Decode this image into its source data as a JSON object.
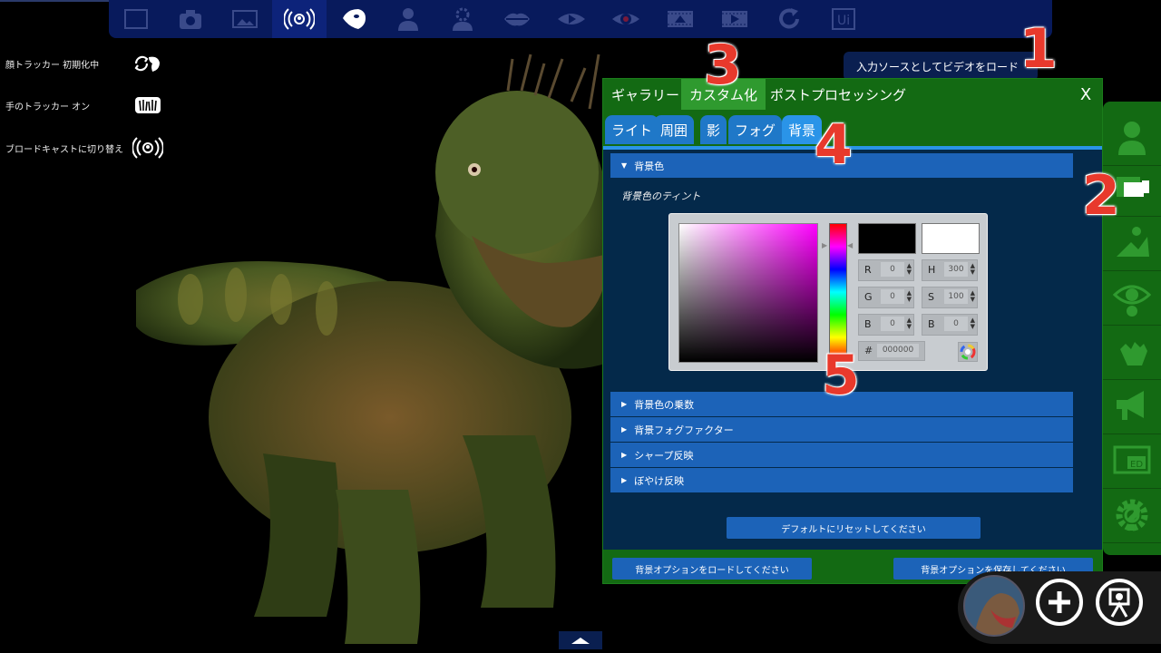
{
  "toolbar": {
    "items": [
      {
        "icon": "fullscreen-icon"
      },
      {
        "icon": "camera-icon"
      },
      {
        "icon": "picture-frame-icon"
      },
      {
        "icon": "broadcast-icon"
      },
      {
        "icon": "face-mask-icon"
      },
      {
        "icon": "person-icon"
      },
      {
        "icon": "person-gear-icon"
      },
      {
        "icon": "lips-icon"
      },
      {
        "icon": "eye-play-icon"
      },
      {
        "icon": "eye-record-icon"
      },
      {
        "icon": "film-up-icon"
      },
      {
        "icon": "film-play-icon"
      },
      {
        "icon": "refresh-icon"
      },
      {
        "icon": "ui-icon",
        "label": "Ui"
      }
    ],
    "active_index": 3
  },
  "left_toggles": [
    {
      "label": "顔トラッカー 初期化中",
      "icon": "face-tracker-icon"
    },
    {
      "label": "手のトラッカー オン",
      "icon": "hands-icon"
    },
    {
      "label": "ブロードキャストに切り替え",
      "icon": "broadcast-icon"
    }
  ],
  "tooltip": "入力ソースとしてビデオをロード",
  "annotations": [
    "1",
    "2",
    "3",
    "4",
    "5"
  ],
  "panel": {
    "main_tabs": [
      "ギャラリー",
      "カスタム化",
      "ポストプロセッシング"
    ],
    "active_main_tab": 1,
    "close_label": "X",
    "sub_tabs": [
      "ライト",
      "周囲",
      "影",
      "フォグ",
      "背景"
    ],
    "active_sub_tab": 4,
    "expanded_section": "背景色",
    "tint_label": "背景色のティント",
    "color_picker": {
      "current_color": "#000000",
      "previous_color": "#ffffff",
      "fields": {
        "R": "0",
        "G": "0",
        "B_rgb": "0",
        "H": "300",
        "S": "100",
        "B_hsb": "0"
      },
      "hex_label": "#",
      "hex": "000000"
    },
    "collapsed_sections": [
      "背景色の乗数",
      "背景フォグファクター",
      "シャープ反映",
      "ぼやけ反映"
    ],
    "reset_button": "デフォルトにリセットしてください",
    "load_button": "背景オプションをロードしてください",
    "save_button": "背景オプションを保存してください"
  },
  "sidebar_icons": [
    "avatar-icon",
    "scene-icon",
    "pose-icon",
    "eye-tracking-icon",
    "hand-icon",
    "megaphone-icon",
    "video-ed-icon",
    "settings-icon",
    "help-icon"
  ],
  "sidebar_labels": {
    "video_ed": "ED",
    "help": "?"
  },
  "bottom_buttons": [
    "character-thumbnail",
    "add-icon",
    "camera-record-icon"
  ],
  "colors": {
    "toolbar_bg": "#081a5c",
    "panel_green": "#136a13",
    "panel_body": "#04294a",
    "tab_blue": "#1f78c8",
    "section_blue": "#1c63b8",
    "annotation_red": "#e8392c"
  }
}
